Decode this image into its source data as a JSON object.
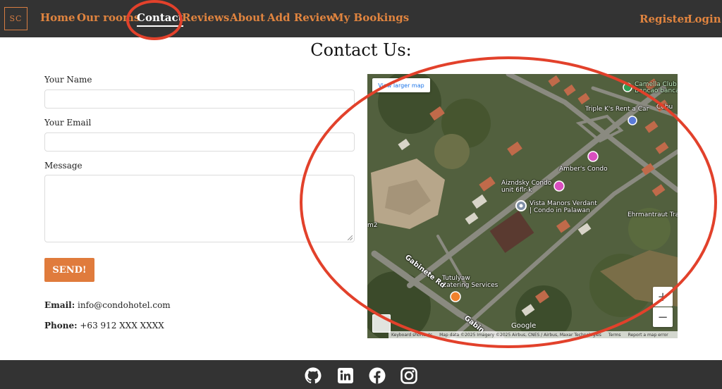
{
  "nav": {
    "logo": "SC",
    "links": [
      "Home",
      "Our rooms",
      "Contact",
      "Reviews",
      "About",
      "Add Review",
      "My Bookings"
    ],
    "register": "Register",
    "login": "Login"
  },
  "page": {
    "title": "Contact Us:"
  },
  "form": {
    "name_label": "Your Name",
    "email_label": "Your Email",
    "message_label": "Message",
    "send_label": "SEND!"
  },
  "contact": {
    "email_label": "Email:",
    "email_value": "info@condohotel.com",
    "phone_label": "Phone:",
    "phone_value": "+63 912 XXX XXXX"
  },
  "map": {
    "larger_map": "View larger map",
    "places": {
      "camella": "Camella Club",
      "camella2": "Bancao bancao",
      "triplek": "Triple K's Rent a Car",
      "ambers": "Amber's Condo",
      "aizndsky": "Aizndsky Condo\nunit 6flr-k",
      "vista": "Vista Manors Verdant\n| Condo in Palawan",
      "ehrmantraut": "Ehrmantraut Tra",
      "tutulyaw": "Tutulyaw\nCatering Services",
      "cebu": "Cebu",
      "m2": "m2"
    },
    "roads": {
      "gabinete": "Gabinete Rd",
      "gabin": "Gabin"
    },
    "zoom_in": "+",
    "zoom_out": "−",
    "google": "Google",
    "attribution": {
      "keyboard": "Keyboard shortcuts",
      "data": "Map data ©2025 Imagery ©2025 Airbus, CNES / Airbus, Maxar Technologies",
      "terms": "Terms",
      "report": "Report a map error"
    }
  },
  "footer": {
    "icons": [
      "github-icon",
      "linkedin-icon",
      "facebook-icon",
      "instagram-icon"
    ]
  },
  "colors": {
    "accent": "#e07b3c",
    "nav_bg": "#333333",
    "annotation": "#e2412b"
  }
}
